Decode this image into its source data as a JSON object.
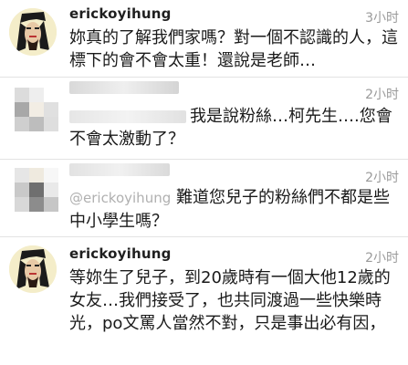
{
  "comments": [
    {
      "username": "erickoyihung",
      "time": "3小时",
      "text": "妳真的了解我們家嗎？對一個不認識的人，這標下的會不會太重！還說是老師…"
    },
    {
      "username": "",
      "time": "2小时",
      "text": "我是說粉絲…柯先生….您會不會太激動了？"
    },
    {
      "username": "@erickoyihung",
      "time": "2小时",
      "text": "難道您兒子的粉絲們不都是些中小學生嗎？"
    },
    {
      "username": "erickoyihung",
      "time": "2小时",
      "text": "等妳生了兒子，到20歲時有一個大他12歲的女友…我們接受了，也共同渡過一些快樂時光，po文罵人當然不對，只是事出必有因，"
    }
  ]
}
